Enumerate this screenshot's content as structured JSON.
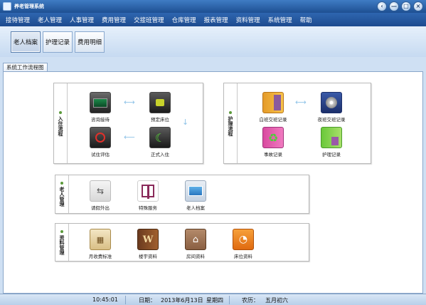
{
  "window": {
    "title": "养老管理系统",
    "buttons": [
      "‹",
      "—",
      "□",
      "×"
    ]
  },
  "menu": [
    "接待管理",
    "老人管理",
    "人事管理",
    "费用管理",
    "交接班管理",
    "仓库管理",
    "报表管理",
    "资料管理",
    "系统管理",
    "帮助"
  ],
  "toolbar": {
    "buttons": [
      "老人档案",
      "护理记录",
      "费用明细"
    ],
    "active": 0
  },
  "tab": {
    "label": "系统工作流程图"
  },
  "groups": {
    "admission": {
      "label": "入住流程",
      "items": [
        "咨询接待",
        "预定床位",
        "试住评估",
        "正式入住"
      ]
    },
    "care": {
      "label": "护理流程",
      "items": [
        "白班交班记录",
        "夜班交班记录",
        "事故记录",
        "护理记录"
      ]
    },
    "elder": {
      "label": "老人管理",
      "items": [
        "请假外出",
        "特殊服务",
        "老人档案"
      ]
    },
    "data": {
      "label": "资料管理",
      "items": [
        "月收费标准",
        "楼宇资料",
        "房间资料",
        "床位资料"
      ]
    }
  },
  "status": {
    "time": "10:45:01",
    "date_label": "日期：",
    "date": "2013年6月13日",
    "weekday": "星期四",
    "lunar_label": "农历：",
    "lunar": "五月初六"
  },
  "icons": [
    "consult-screen-icon",
    "lock-reserve-icon",
    "trial-assess-icon",
    "moon-checkin-icon",
    "day-shift-folder-icon",
    "night-shift-cd-icon",
    "incident-recycle-icon",
    "nursing-record-icon",
    "usb-leave-icon",
    "gift-service-icon",
    "elder-archive-icon",
    "calendar-fee-icon",
    "building-book-icon",
    "room-house-icon",
    "bed-rss-icon"
  ]
}
